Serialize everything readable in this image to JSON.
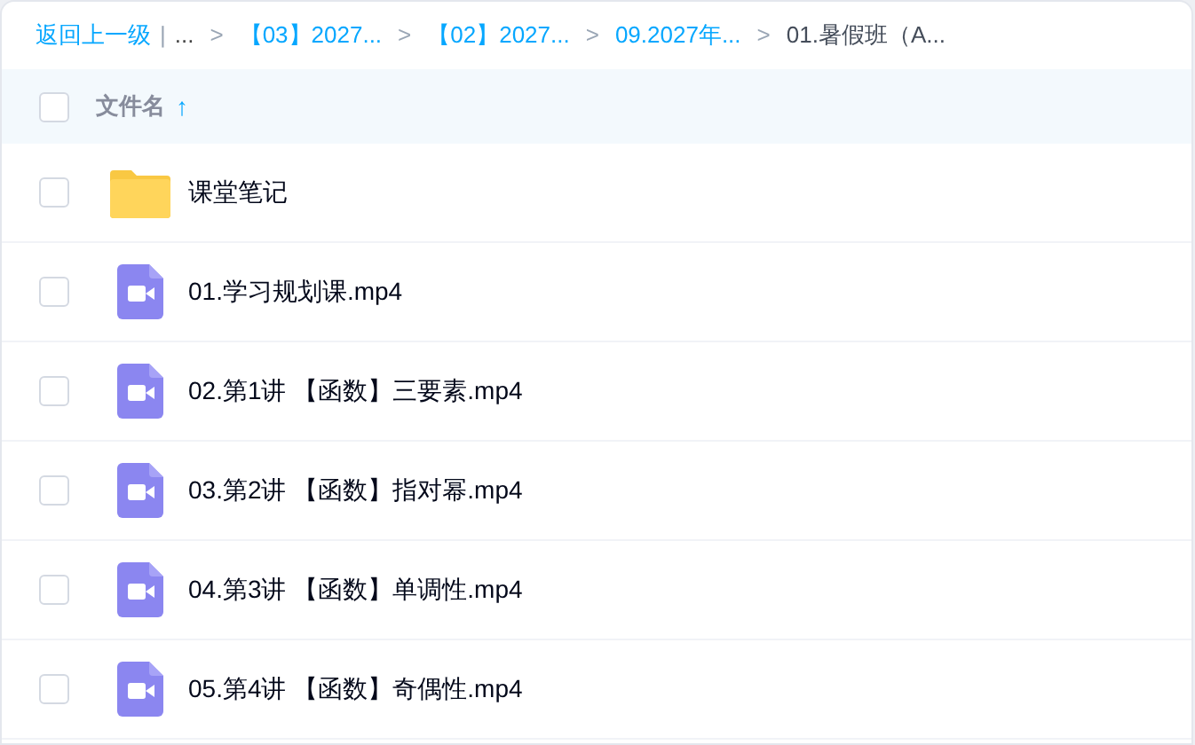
{
  "breadcrumb": {
    "back": "返回上一级",
    "divider": "|",
    "ellipsis": "...",
    "separator": ">",
    "items": [
      {
        "label": "【03】2027...",
        "current": false
      },
      {
        "label": "【02】2027...",
        "current": false
      },
      {
        "label": "09.2027年...",
        "current": false
      },
      {
        "label": "01.暑假班（A...",
        "current": true
      }
    ]
  },
  "table": {
    "header": {
      "label": "文件名",
      "sort_arrow": "↑",
      "checked": false
    },
    "rows": [
      {
        "kind": "folder",
        "name": "课堂笔记",
        "checked": false
      },
      {
        "kind": "video",
        "name": "01.学习规划课.mp4",
        "checked": false
      },
      {
        "kind": "video",
        "name": "02.第1讲 【函数】三要素.mp4",
        "checked": false
      },
      {
        "kind": "video",
        "name": "03.第2讲 【函数】指对幂.mp4",
        "checked": false
      },
      {
        "kind": "video",
        "name": "04.第3讲 【函数】单调性.mp4",
        "checked": false
      },
      {
        "kind": "video",
        "name": "05.第4讲 【函数】奇偶性.mp4",
        "checked": false
      }
    ]
  }
}
